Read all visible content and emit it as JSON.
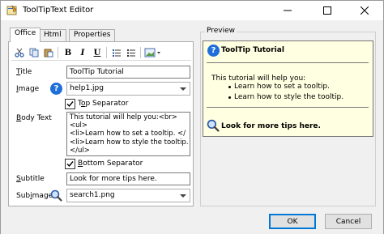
{
  "window": {
    "title": "ToolTipText Editor"
  },
  "tabs": [
    {
      "label": "Office",
      "active": true
    },
    {
      "label": "Html",
      "active": false
    },
    {
      "label": "Properties",
      "active": false
    }
  ],
  "toolbar": {
    "bold": "B",
    "italic": "I",
    "underline": "U"
  },
  "form": {
    "title_label": "Title",
    "title_value": "ToolTip Tutorial",
    "image_label": "Image",
    "image_value": "help1.jpg",
    "top_separator_label": "Top Separator",
    "top_separator_checked": true,
    "body_label": "Body Text",
    "body_lines": [
      "This tutorial will help you:<br>",
      "<ul>",
      "<li>Learn how to set a tooltip. </",
      "<li>Learn how to style the tooltip. </",
      "</ul>"
    ],
    "bottom_separator_label": "Bottom Separator",
    "bottom_separator_checked": true,
    "subtitle_label": "Subtitle",
    "subtitle_value": "Look for more tips here.",
    "subimage_label": "Subimage",
    "subimage_value": "search1.png"
  },
  "preview": {
    "group_label": "Preview",
    "title": "ToolTip Tutorial",
    "intro": "This tutorial will help you:",
    "bullets": [
      "Learn how to set a tooltip.",
      "Learn how to style the tooltip."
    ],
    "footer": "Look for more tips here."
  },
  "buttons": {
    "ok": "OK",
    "cancel": "Cancel"
  },
  "colors": {
    "tooltip_bg": "#ffffe1",
    "help_icon": "#1e6fd9",
    "default_button_border": "#0078d7"
  }
}
